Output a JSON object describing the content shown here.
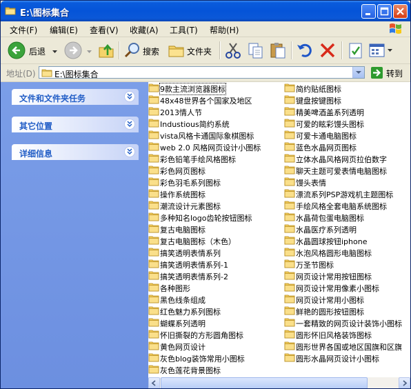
{
  "window": {
    "title": "E:\\图标集合",
    "accent": "#0554d8"
  },
  "menu": {
    "items": [
      "文件(F)",
      "编辑(E)",
      "查看(V)",
      "收藏(A)",
      "工具(T)",
      "帮助(H)"
    ]
  },
  "toolbar": {
    "back_label": "后退",
    "search_label": "搜索",
    "folders_label": "文件夹"
  },
  "address": {
    "label": "地址(D)",
    "value": "E:\\图标集合",
    "go_label": "转到"
  },
  "tasks": {
    "panels": [
      "文件和文件夹任务",
      "其它位置",
      "详细信息"
    ]
  },
  "files": {
    "col1": [
      "9款主流浏览器图标",
      "48x48世界各个国家及地区",
      "2013情人节",
      "Industious简约系统",
      "vista风格卡通国际象棋图标",
      "web 2.0 风格网页设计小图标",
      "彩色铅笔手绘风格图标",
      "彩色网页图标",
      "彩色羽毛系列图标",
      "操作系统图标",
      "潮流设计元素图标",
      "多种知名logo齿轮按钮图标",
      "复古电脑图标",
      "复古电脑图标（木色）",
      "搞笑透明表情系列",
      "搞笑透明表情系列-1",
      "搞笑透明表情系列-2",
      "各种图形",
      "黑色线条组成",
      "红色魅力系列图标",
      "蝴蝶系列透明",
      "怀旧撕裂的方形圆角图标",
      "黄色网页设计",
      "灰色blog装饰常用小图标",
      "灰色莲花背景图标"
    ],
    "col2": [
      "简约贴纸图标",
      "键盘按键图标",
      "精美啤酒盖系列透明",
      "可爱的眩彩馒头图标",
      "可爱卡通电脑图标",
      "蓝色水晶网页图标",
      "立体水晶风格网页拉伯数字",
      "聊天主题可爱表情电脑图标",
      "馒头表情",
      "漂流系列PSP游戏机主题图标",
      "手绘风格全套电脑系统图标",
      "水晶荷包蛋电脑图标",
      "水晶医疗系列透明",
      "水晶圆球按钮iphone",
      "水泡风格圆形电脑图标",
      "万圣节图标",
      "网页设计常用按钮图标",
      "网页设计常用像素小图标",
      "网页设计常用小图标",
      "鲜艳的圆形按钮图标",
      "一套精致的网页设计装饰小图标",
      "圆形怀旧风格装饰图标",
      "圆形世界各国或地区国旗和区旗",
      "圆形水晶网页设计小图标"
    ]
  }
}
